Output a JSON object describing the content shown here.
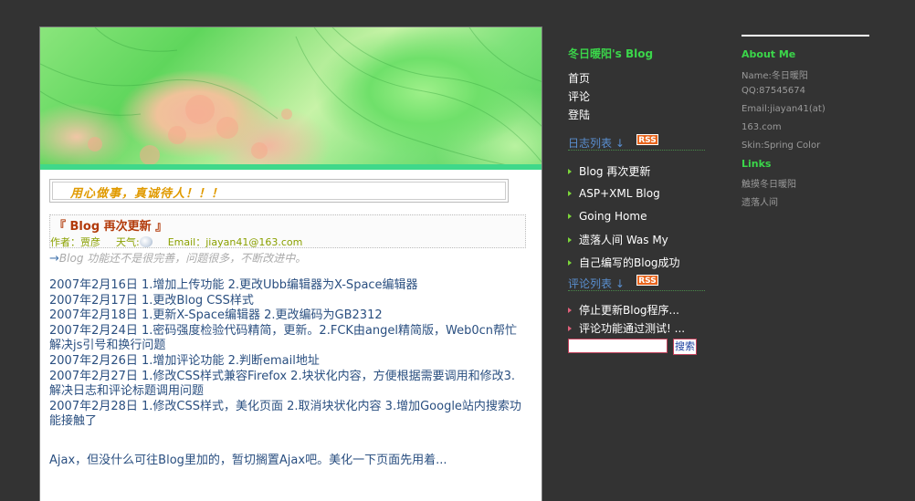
{
  "banner": {
    "alt": "fractal-banner"
  },
  "post": {
    "motto": "用心做事，真诚待人！！！",
    "title": "『 Blog 再次更新 』",
    "author_label": "作者：",
    "author": "贾彦",
    "weather_label": "天气:",
    "email_label": "Email：",
    "email": "jiayan41@163.com",
    "summary_arrow": "→",
    "summary": "Blog 功能还不是很完善，问题很多，不断改进中。",
    "changelog": [
      "2007年2月16日 1.增加上传功能 2.更改Ubb编辑器为X-Space编辑器",
      "2007年2月17日 1.更改Blog CSS样式",
      "2007年2月18日 1.更新X-Space编辑器 2.更改编码为GB2312",
      "2007年2月24日 1.密码强度检验代码精简，更新。2.FCK由angel精简版，Web0cn帮忙解决js引号和换行问题",
      "2007年2月26日 1.增加评论功能 2.判断email地址",
      "2007年2月27日 1.修改CSS样式兼容Firefox 2.块状化内容，方便根据需要调用和修改3.解决日志和评论标题调用问题",
      "2007年2月28日 1.修改CSS样式，美化页面 2.取消块状化内容 3.增加Google站内搜索功能接触了"
    ],
    "ajax_line": "Ajax，但没什么可往Blog里加的，暂切搁置Ajax吧。美化一下页面先用着..."
  },
  "sidebar": {
    "blog_title": "冬日暖阳's Blog",
    "nav": [
      "首页",
      "评论",
      "登陆"
    ],
    "log_list_title": "日志列表 ↓",
    "rss_label": "RSS",
    "log_items": [
      "Blog 再次更新",
      "ASP+XML Blog",
      "Going Home",
      "遗落人间 Was My",
      "自己编写的Blog成功"
    ],
    "comment_list_title": "评论列表 ↓",
    "comment_items": [
      "停止更新Blog程序...",
      "评论功能通过测试! ..."
    ],
    "search_value": "",
    "search_button": "搜索"
  },
  "about": {
    "heading": "About Me",
    "name": "Name:冬日暖阳",
    "qq": "QQ:87545674",
    "email_line1": "Email:jiayan41(at)",
    "email_line2": "163.com",
    "skin": "Skin:Spring Color",
    "links_heading": "Links",
    "links": [
      "触摸冬日暖阳",
      "遗落人间"
    ]
  },
  "colors": {
    "background": "#333333",
    "accent_green": "#3bd64a",
    "link_blue": "#2a4f80",
    "title_red": "#b23a0a",
    "motto_orange": "#e09a00",
    "rss_orange": "#e8641c"
  }
}
